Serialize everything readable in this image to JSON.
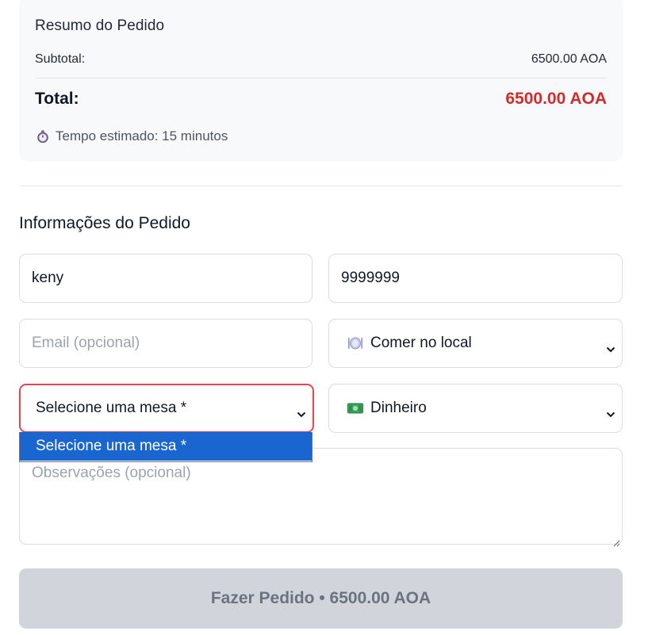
{
  "summary": {
    "title": "Resumo do Pedido",
    "subtotal_label": "Subtotal:",
    "subtotal_value": "6500.00 AOA",
    "total_label": "Total:",
    "total_value": "6500.00 AOA",
    "eta_icon": "stopwatch-icon",
    "eta_text": "Tempo estimado: 15 minutos",
    "total_color": "#d22b2b"
  },
  "form": {
    "title": "Informações do Pedido",
    "name_value": "keny",
    "phone_value": "9999999",
    "email_placeholder": "Email (opcional)",
    "order_type": {
      "icon": "plate-cutlery-icon",
      "selected": "Comer no local"
    },
    "table_select": {
      "selected": "Selecione uma mesa *",
      "options": [
        "Selecione uma mesa *"
      ]
    },
    "payment": {
      "icon": "cash-icon",
      "selected": "Dinheiro"
    },
    "notes_placeholder": "Observações (opcional)",
    "submit_label": "Fazer Pedido • 6500.00 AOA"
  },
  "colors": {
    "error_border": "#e0474f",
    "dropdown_highlight": "#1a66d0",
    "submit_disabled_bg": "#d1d5db"
  }
}
